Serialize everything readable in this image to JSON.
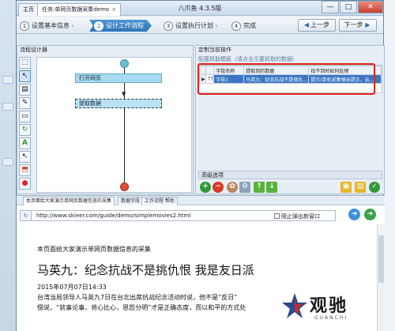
{
  "window": {
    "title": "八爪鱼 4.3.5版",
    "tabs": [
      {
        "label": "主页"
      },
      {
        "label": "任务:单网页数据采集demo",
        "close": "×"
      }
    ],
    "controls": {
      "minimize": "—",
      "maximize": "□",
      "close": "✕"
    }
  },
  "steps": {
    "items": [
      {
        "num": "1",
        "label": "设置基本信息"
      },
      {
        "num": "2",
        "label": "设计工作流程"
      },
      {
        "num": "3",
        "label": "设置执行计划"
      },
      {
        "num": "4",
        "label": "完成"
      }
    ],
    "prev_label": "上一步",
    "next_label": "下一步"
  },
  "flow": {
    "header": "流程设计器",
    "nodes": [
      {
        "label": "打开网页"
      },
      {
        "label": "提取数据"
      }
    ],
    "tools": [
      "pointer-icon",
      "loop-icon",
      "list-icon",
      "toggle-icon",
      "cycle-icon",
      "text-icon",
      "cursor-icon",
      "branch-icon",
      "stop-icon"
    ]
  },
  "right": {
    "header": "定制当前操作",
    "sub_header": "配置抓取模板（请点击示要抓取的数据）",
    "columns": [
      "字段名称",
      "提取到的数据",
      "找不到时如何处理"
    ],
    "rows": [
      {
        "marker": "▶",
        "type": "TT",
        "name": "字段1",
        "value": "马英九：纪念抗战不是挑仇...",
        "handling": "提示(单机采集弹出提示，云..."
      }
    ],
    "advanced": "高级选项"
  },
  "browser": {
    "tabs": [
      {
        "label": "本页面给大家演示单网页数据信息的采集"
      },
      {
        "label": "数据字段"
      },
      {
        "label": "工作流程 帮助"
      }
    ],
    "url": "http://www.skieer.com/guide/demo/simplemovies2.html",
    "popup_label": "阻止弹出新窗口",
    "page": {
      "intro": "本页面给大家演示单网页数据信息的采集",
      "headline": "马英九：纪念抗战不是挑仇恨 我是友日派",
      "date": "2015年07月07日14:33",
      "p1": "台湾当局领导人马英九7日在台北出席抗战纪念活动时说，他不是“反日”",
      "p2": "偿说，“就事论事，将心比心，恩怨分明”才是正确态度，而以和平的方式处"
    }
  },
  "watermark": {
    "cn": "观驰",
    "en": "GUANCHI"
  }
}
